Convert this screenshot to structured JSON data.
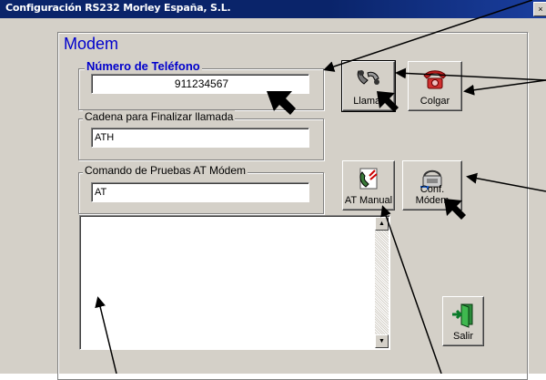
{
  "window": {
    "title": "Configuración RS232 Morley España, S.L.",
    "close_glyph": "×"
  },
  "frame": {
    "title": "Modem"
  },
  "phone": {
    "label": "Número de Teléfono",
    "value": "911234567"
  },
  "hangup_string": {
    "label": "Cadena para Finalizar llamada",
    "value": "ATH"
  },
  "test_command": {
    "label": "Comando de Pruebas AT Módem",
    "value": "AT"
  },
  "buttons": {
    "call": "Llamar",
    "hangup": "Colgar",
    "at_manual": "AT Manual",
    "conf_modem": "Conf. Módem",
    "exit": "Salir"
  },
  "scroll": {
    "up": "▲",
    "down": "▼"
  },
  "colors": {
    "title_bar": "#0a246a",
    "dialog": "#d4d0c8",
    "accent_text": "#0000cc"
  },
  "icons": [
    "phone-handset-icon",
    "red-telephone-icon",
    "phone-script-icon",
    "modem-config-icon",
    "exit-door-icon"
  ]
}
